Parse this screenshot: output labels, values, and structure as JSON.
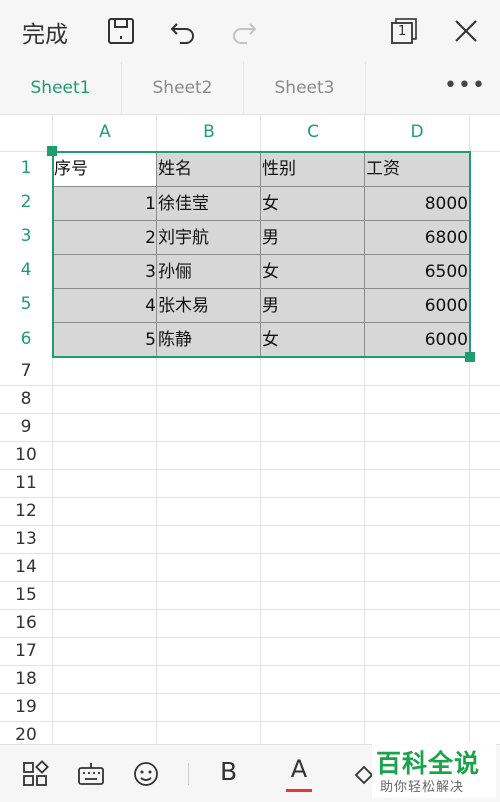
{
  "toolbar": {
    "done_label": "完成",
    "window_count": "1",
    "icons": [
      "save-icon",
      "undo-icon",
      "redo-icon",
      "window-switch-icon",
      "close-icon"
    ]
  },
  "sheets": {
    "tabs": [
      "Sheet1",
      "Sheet2",
      "Sheet3"
    ],
    "active": "Sheet1",
    "more_label": "•••"
  },
  "grid": {
    "columns": [
      "A",
      "B",
      "C",
      "D"
    ],
    "rows": [
      "1",
      "2",
      "3",
      "4",
      "5",
      "6",
      "7",
      "8",
      "9",
      "10",
      "11",
      "12",
      "13",
      "14",
      "15",
      "16",
      "17",
      "18",
      "19",
      "20"
    ],
    "selected_rows": 6,
    "cells": [
      [
        "序号",
        "姓名",
        "性别",
        "工资"
      ],
      [
        "1",
        "徐佳莹",
        "女",
        "8000"
      ],
      [
        "2",
        "刘宇航",
        "男",
        "6800"
      ],
      [
        "3",
        "孙俪",
        "女",
        "6500"
      ],
      [
        "4",
        "张木易",
        "男",
        "6000"
      ],
      [
        "5",
        "陈静",
        "女",
        "6000"
      ]
    ]
  },
  "bottom_toolbar": {
    "bold_label": "B",
    "font_color_label": "A",
    "font_color": "#e53935",
    "icons": [
      "apps-grid-icon",
      "keyboard-icon",
      "smiley-icon",
      "fill-bucket-icon"
    ]
  },
  "watermark": {
    "main": "百科全说",
    "sub": "助你轻松解决"
  },
  "colors": {
    "accent": "#1e9e6e",
    "selection_fill": "#d7d7d7"
  }
}
